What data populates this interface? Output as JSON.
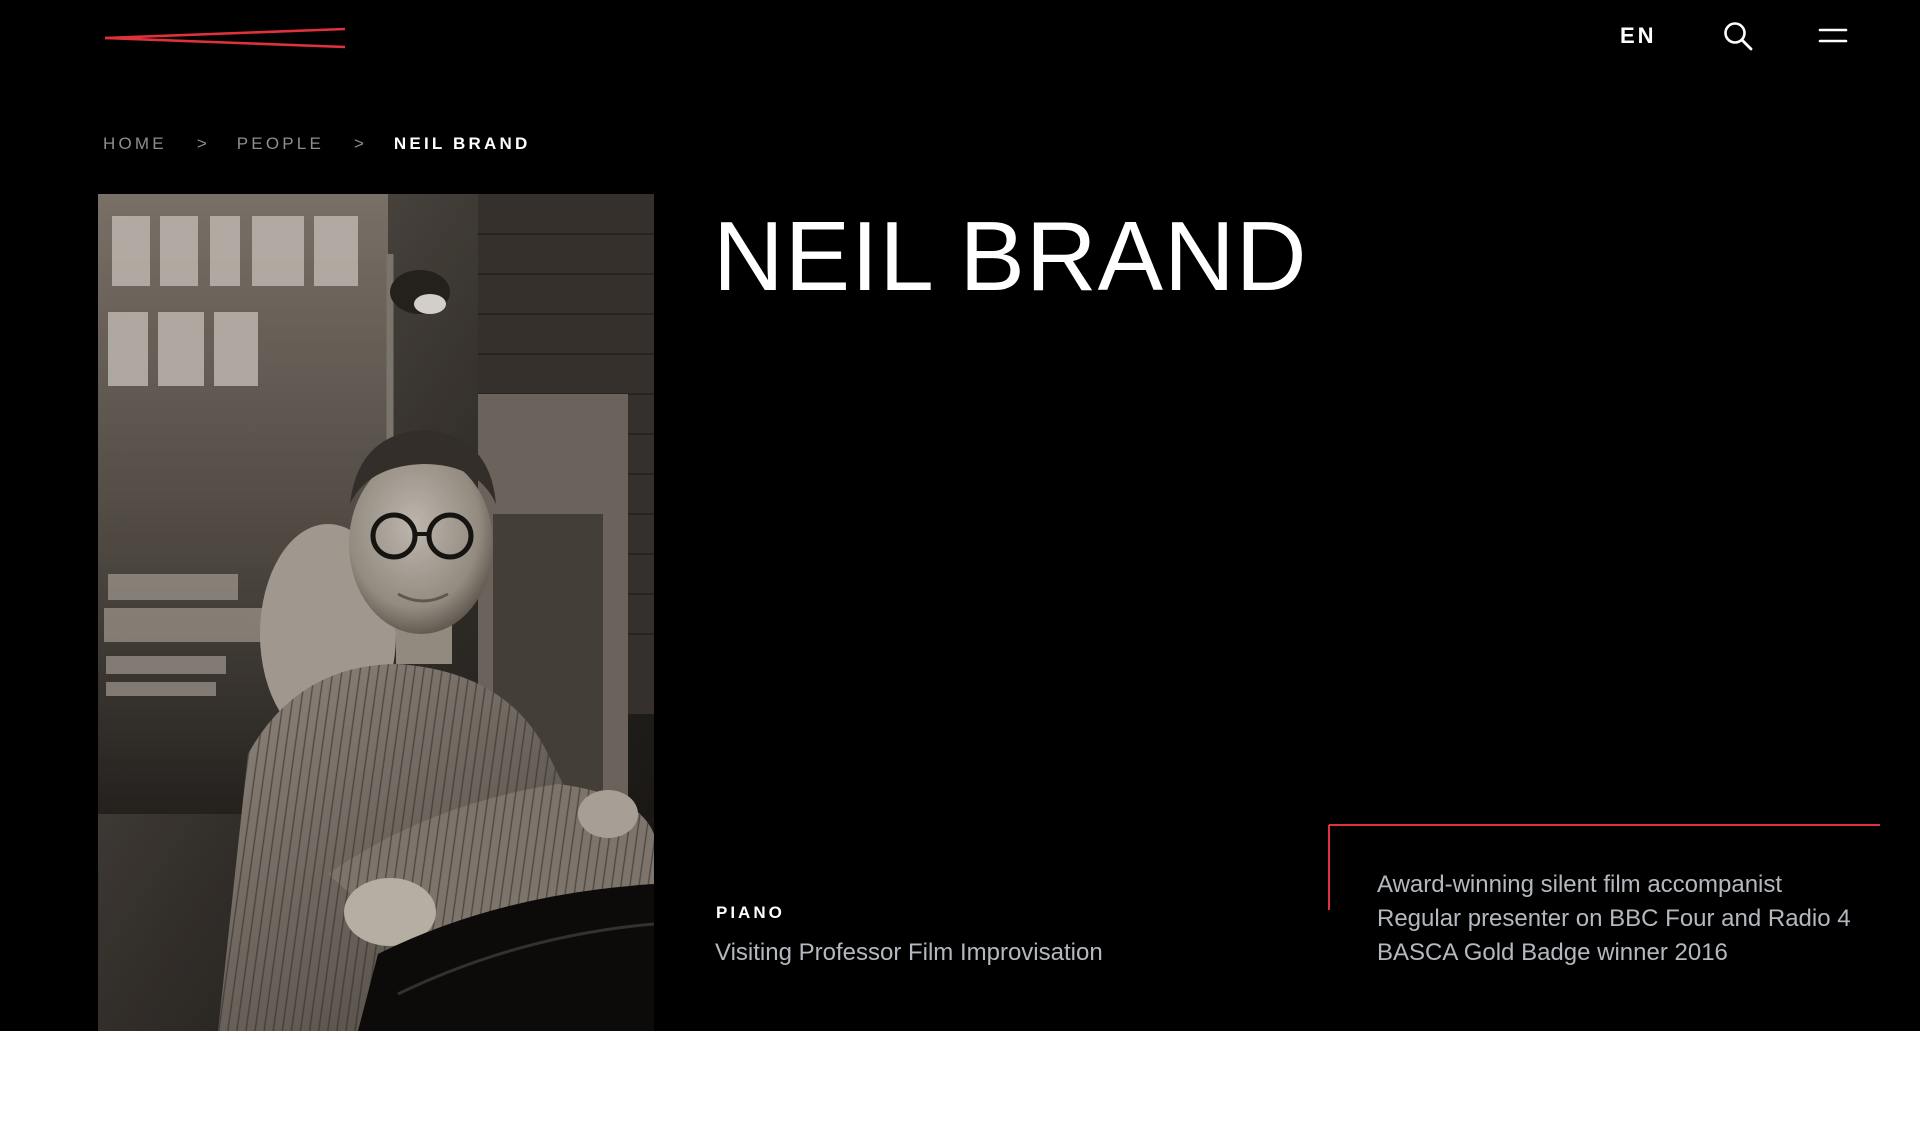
{
  "header": {
    "logo_icon": "red-lines-logo-icon",
    "language": "EN",
    "search_icon": "search-icon",
    "menu_icon": "hamburger-menu-icon",
    "accent_color": "#e0323c"
  },
  "breadcrumb": {
    "items": [
      {
        "label": "HOME"
      },
      {
        "label": "PEOPLE"
      }
    ],
    "separator": ">",
    "current": "NEIL BRAND"
  },
  "profile": {
    "name": "NEIL BRAND",
    "department": "PIANO",
    "role": "Visiting Professor Film Improvisation",
    "highlights": [
      "Award-winning silent film accompanist",
      "Regular presenter on BBC Four and Radio 4",
      "BASCA Gold Badge winner 2016"
    ]
  },
  "colors": {
    "background": "#000000",
    "text": "#ffffff",
    "muted_text": "#b4b8bf",
    "breadcrumb_text": "#8b8e94",
    "accent": "#e0323c"
  }
}
